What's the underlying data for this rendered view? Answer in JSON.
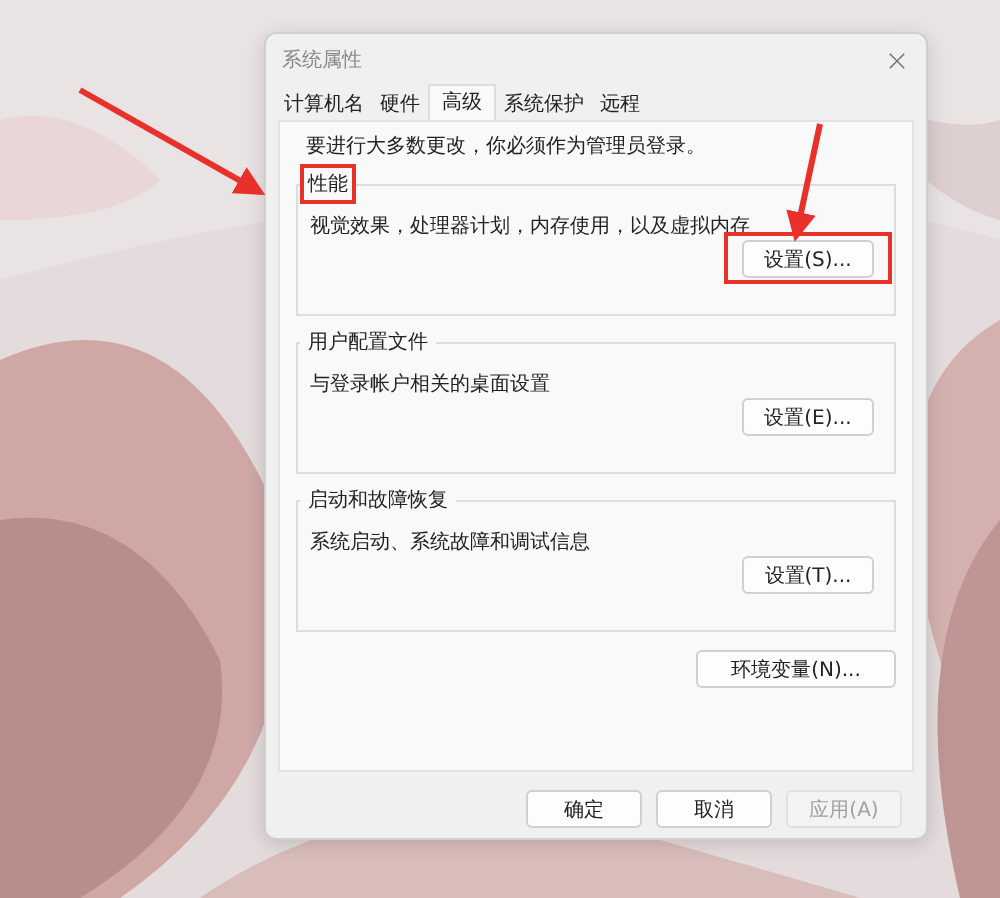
{
  "window": {
    "title": "系统属性"
  },
  "tabs": [
    {
      "label": "计算机名",
      "selected": false
    },
    {
      "label": "硬件",
      "selected": false
    },
    {
      "label": "高级",
      "selected": true
    },
    {
      "label": "系统保护",
      "selected": false
    },
    {
      "label": "远程",
      "selected": false
    }
  ],
  "notice": "要进行大多数更改，你必须作为管理员登录。",
  "groups": [
    {
      "title": "性能",
      "description": "视觉效果，处理器计划，内存使用，以及虚拟内存",
      "button": "设置(S)...",
      "title_highlighted": true,
      "button_highlighted": true
    },
    {
      "title": "用户配置文件",
      "description": "与登录帐户相关的桌面设置",
      "button": "设置(E)...",
      "title_highlighted": false,
      "button_highlighted": false
    },
    {
      "title": "启动和故障恢复",
      "description": "系统启动、系统故障和调试信息",
      "button": "设置(T)...",
      "title_highlighted": false,
      "button_highlighted": false
    }
  ],
  "env_button": "环境变量(N)...",
  "buttons": [
    {
      "label": "确定",
      "disabled": false
    },
    {
      "label": "取消",
      "disabled": false
    },
    {
      "label": "应用(A)",
      "disabled": true
    }
  ]
}
